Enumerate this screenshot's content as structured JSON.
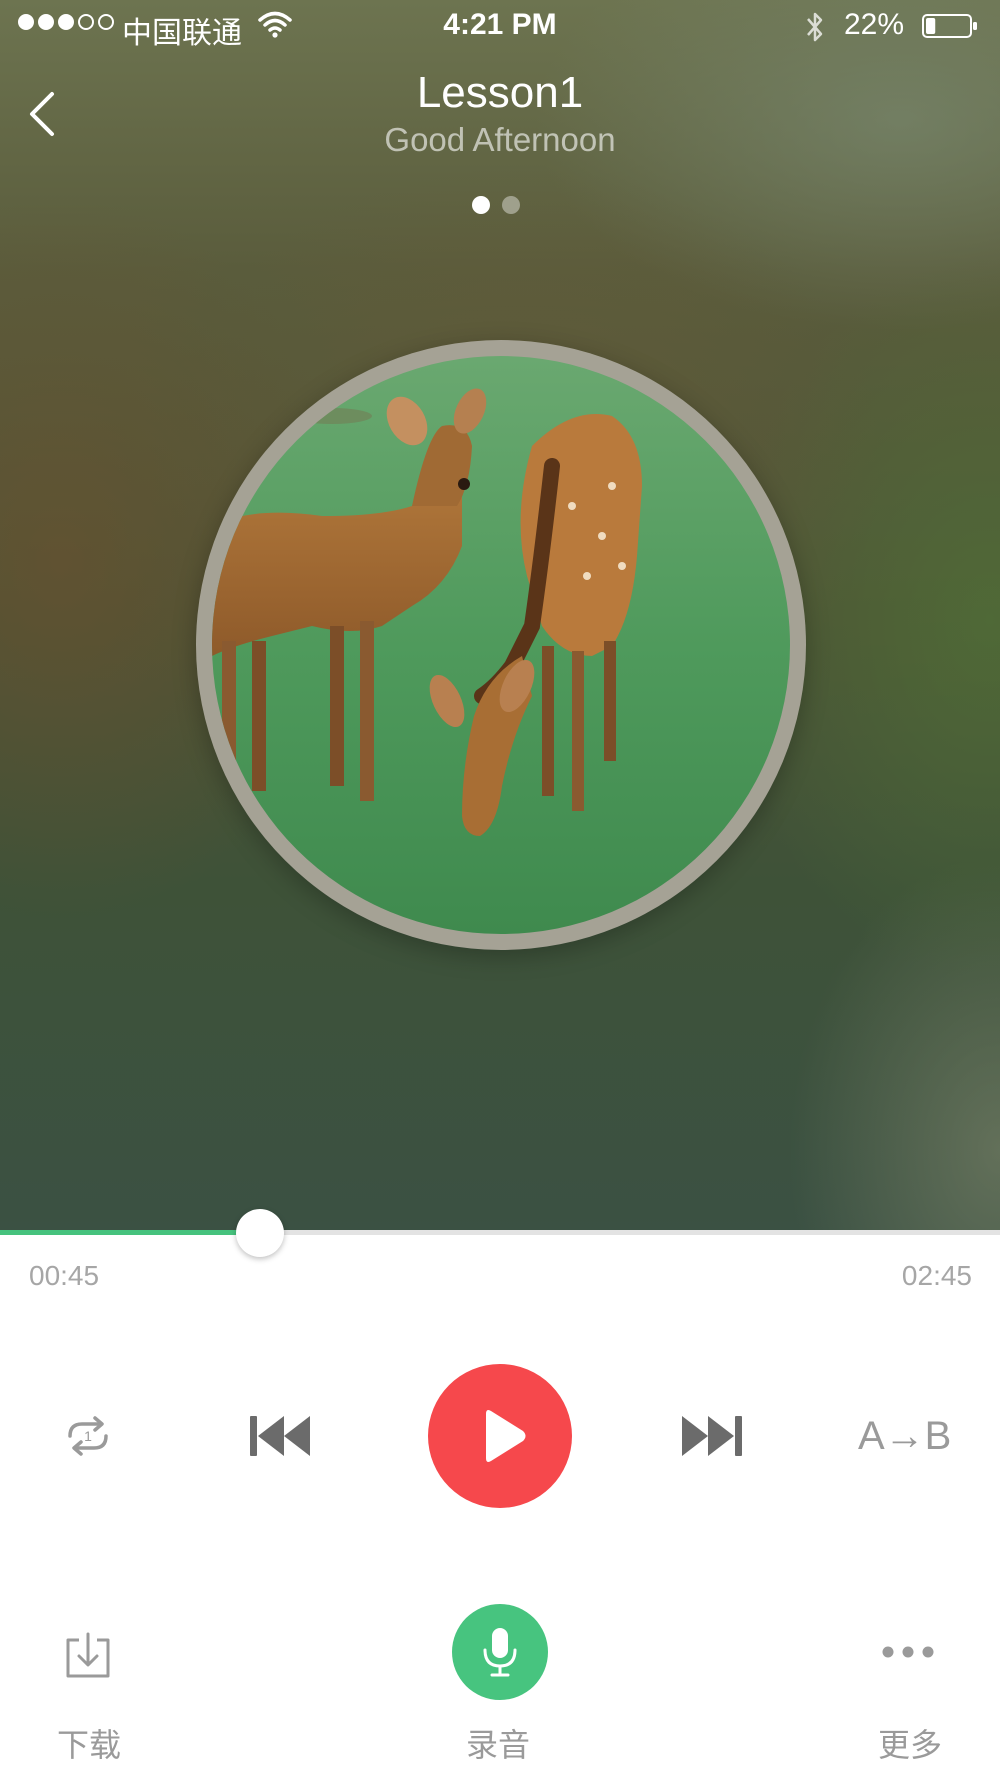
{
  "status_bar": {
    "carrier": "中国联通",
    "time": "4:21 PM",
    "battery_percent": "22%",
    "signal_bars_filled": 3,
    "signal_bars_total": 5,
    "battery_level": 0.22
  },
  "header": {
    "title": "Lesson1",
    "subtitle": "Good Afternoon",
    "back_icon": "chevron-left-icon"
  },
  "pager": {
    "pages": 2,
    "active_index": 0
  },
  "album": {
    "image": "two deer grazing on grass"
  },
  "player": {
    "current_time": "00:45",
    "total_time": "02:45",
    "progress": 0.26,
    "progress_color": "#46c27d",
    "play_button_color": "#f6484c",
    "controls": {
      "repeat_icon": "repeat-one-icon",
      "previous_icon": "skip-previous-icon",
      "play_icon": "play-icon",
      "next_icon": "skip-next-icon",
      "ab_repeat_label": "A→B"
    }
  },
  "bottom_bar": {
    "download_label": "下载",
    "record_label": "录音",
    "more_label": "更多",
    "record_button_color": "#47c47f",
    "download_icon": "download-icon",
    "record_icon": "microphone-icon",
    "more_icon": "more-horizontal-icon"
  }
}
